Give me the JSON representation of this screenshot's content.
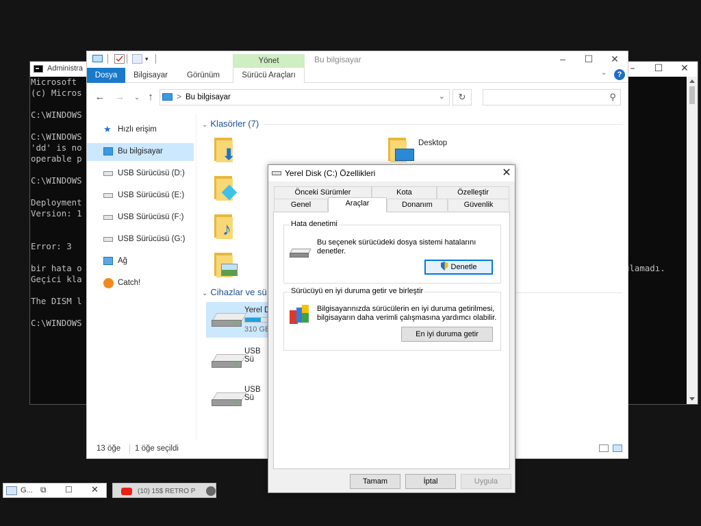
{
  "cmd": {
    "title": "Administra",
    "lines": [
      "Microsoft",
      "(c) Micros",
      "",
      "C:\\WINDOWS",
      "",
      "C:\\WINDOWS",
      "'dd' is no",
      "operable p",
      "",
      "C:\\WINDOWS",
      "",
      "Deployment",
      "Version: 1",
      "",
      "",
      "Error: 3",
      "",
      "bir hata o",
      "Geçici kla",
      "",
      "The DISM l",
      "",
      "C:\\WINDOWS"
    ],
    "right_fragment": "ulamadı."
  },
  "explorer": {
    "title": "Bu bilgisayar",
    "ribbon": {
      "context_group": "Yönet",
      "tabs": [
        "Dosya",
        "Bilgisayar",
        "Görünüm",
        "Sürücü Araçları"
      ],
      "help": "?"
    },
    "address": {
      "path": "Bu bilgisayar",
      "separator": ">"
    },
    "search_placeholder": "",
    "nav": [
      {
        "label": "Hızlı erişim"
      },
      {
        "label": "Bu bilgisayar"
      },
      {
        "label": "USB Sürücüsü (D:)"
      },
      {
        "label": "USB Sürücüsü (E:)"
      },
      {
        "label": "USB Sürücüsü (F:)"
      },
      {
        "label": "USB Sürücüsü (G:)"
      },
      {
        "label": "Ağ"
      },
      {
        "label": "Catch!"
      }
    ],
    "groups": {
      "folders": "Klasörler (7)",
      "devices": "Cihazlar ve sü"
    },
    "folders": [
      {
        "label": ""
      },
      {
        "label": "Desktop"
      }
    ],
    "drives": [
      {
        "label": "Yerel D",
        "sub": "310 GB",
        "fill": 0.6
      },
      {
        "label": "USB Sü"
      },
      {
        "label": "USB Sü"
      }
    ],
    "status": {
      "count": "13 öğe",
      "selected": "1 öğe seçildi"
    }
  },
  "props": {
    "title": "Yerel Disk (C:) Özellikleri",
    "tabs_row1": [
      "Önceki Sürümler",
      "Kota",
      "Özelleştir"
    ],
    "tabs_row2": [
      "Genel",
      "Araçlar",
      "Donanım",
      "Güvenlik"
    ],
    "active_tab": "Araçlar",
    "error_check": {
      "title": "Hata denetimi",
      "text": "Bu seçenek sürücüdeki dosya sistemi hatalarını denetler.",
      "button": "Denetle"
    },
    "optimize": {
      "title": "Sürücüyü en iyi duruma getir ve birleştir",
      "text": "Bilgisayarınızda sürücülerin en iyi duruma getirilmesi, bilgisayarın daha verimli çalışmasına yardımcı olabilir.",
      "button": "En iyi duruma getir"
    },
    "buttons": {
      "ok": "Tamam",
      "cancel": "İptal",
      "apply": "Uygula"
    }
  },
  "taskbar": {
    "thumb1": "G...",
    "thumb2": "(10) 15$ RETRO P"
  },
  "colors": {
    "accent": "#1979ca",
    "selection": "#cce8ff",
    "context_tab": "#cfeec3"
  }
}
